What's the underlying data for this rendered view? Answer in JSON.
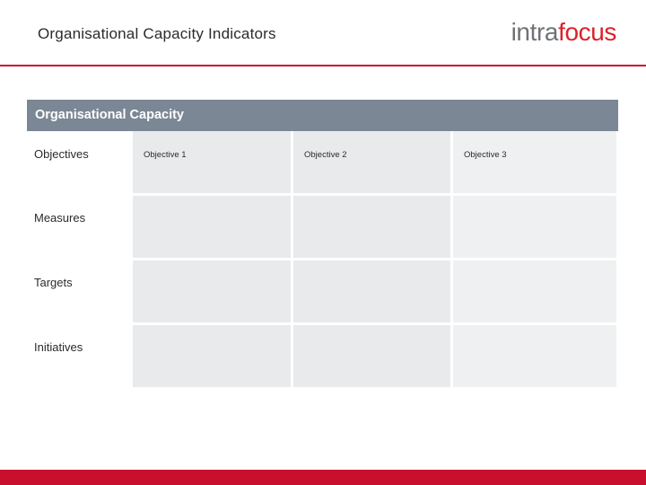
{
  "header": {
    "title": "Organisational Capacity Indicators",
    "logo_first": "intra",
    "logo_second": "focus"
  },
  "matrix": {
    "band_title": "Organisational Capacity",
    "rows": [
      {
        "label": "Objectives",
        "cells": [
          "Objective 1",
          "Objective 2",
          "Objective 3"
        ]
      },
      {
        "label": "Measures",
        "cells": [
          "",
          "",
          ""
        ]
      },
      {
        "label": "Targets",
        "cells": [
          "",
          "",
          ""
        ]
      },
      {
        "label": "Initiatives",
        "cells": [
          "",
          "",
          ""
        ]
      }
    ]
  },
  "colors": {
    "accent_red": "#c8102e",
    "band_grey": "#7c8795",
    "cell_grey": "#e9eaec",
    "cell_grey_alt": "#eff0f1",
    "logo_grey": "#6f7276",
    "logo_red": "#d8232a"
  }
}
